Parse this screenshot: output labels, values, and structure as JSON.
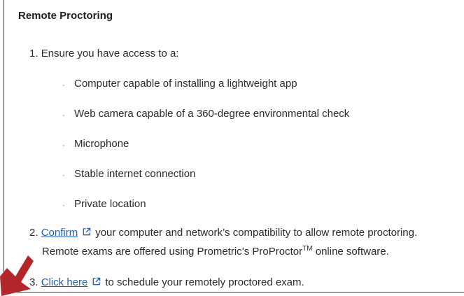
{
  "section": {
    "title": "Remote Proctoring"
  },
  "steps": {
    "step1": {
      "number": "1.",
      "text": "Ensure you have access to a:"
    },
    "requirements": [
      "Computer capable of installing a lightweight app",
      "Web camera capable of a 360-degree environmental check",
      "Microphone",
      "Stable internet connection",
      "Private location"
    ],
    "step2": {
      "number": "2.",
      "link": "Confirm",
      "text": "your computer and network’s compatibility to allow remote proctoring.",
      "line2_prefix": "Remote exams are offered using Prometric’s ProProctor",
      "trademark": "TM",
      "line2_suffix": " online software."
    },
    "step3": {
      "number": "3.",
      "link": "Click here",
      "text": "to schedule your remotely proctored exam."
    }
  },
  "icons": {
    "external_link": "external-link-icon",
    "pointer_arrow": "arrow-icon"
  },
  "colors": {
    "link": "#1f5fae",
    "arrow": "#b3262a",
    "border": "#2b3a55"
  }
}
